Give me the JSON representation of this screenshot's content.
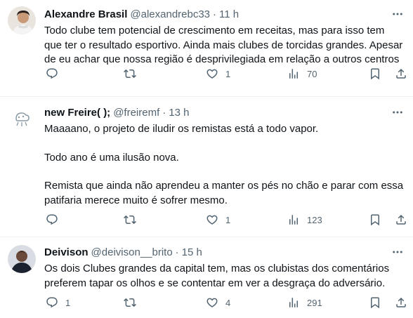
{
  "tweets": [
    {
      "name": "Alexandre Brasil",
      "handle": "@alexandrebc33",
      "dot": "·",
      "time": "11 h",
      "paragraphs": [
        "Todo clube tem potencial de crescimento em receitas, mas para isso tem que ter o resultado esportivo. Ainda mais clubes de torcidas grandes. Apesar de eu achar que nossa região é desprivilegiada em relação a outros centros"
      ],
      "replies": "",
      "retweets": "",
      "likes": "1",
      "views": "70"
    },
    {
      "name": "new Freire( );",
      "handle": "@freiremf",
      "dot": "·",
      "time": "13 h",
      "paragraphs": [
        "Maaaano, o projeto de iludir os remistas está a todo vapor.",
        "Todo ano é uma ilusão nova.",
        "Remista que ainda não aprendeu a manter os pés no chão e parar com essa patifaria merece muito é sofrer mesmo."
      ],
      "replies": "",
      "retweets": "",
      "likes": "1",
      "views": "123"
    },
    {
      "name": "Deivison",
      "handle": "@deivison__brito",
      "dot": "·",
      "time": "15 h",
      "paragraphs": [
        "Os dois Clubes grandes da capital tem, mas os clubistas dos comentários preferem tapar os olhos e se contentar em ver a desgraça do adversário."
      ],
      "replies": "1",
      "retweets": "",
      "likes": "4",
      "views": "291"
    }
  ],
  "colors": {
    "text": "#0f1419",
    "secondary": "#536471",
    "divider": "#eff3f4"
  }
}
